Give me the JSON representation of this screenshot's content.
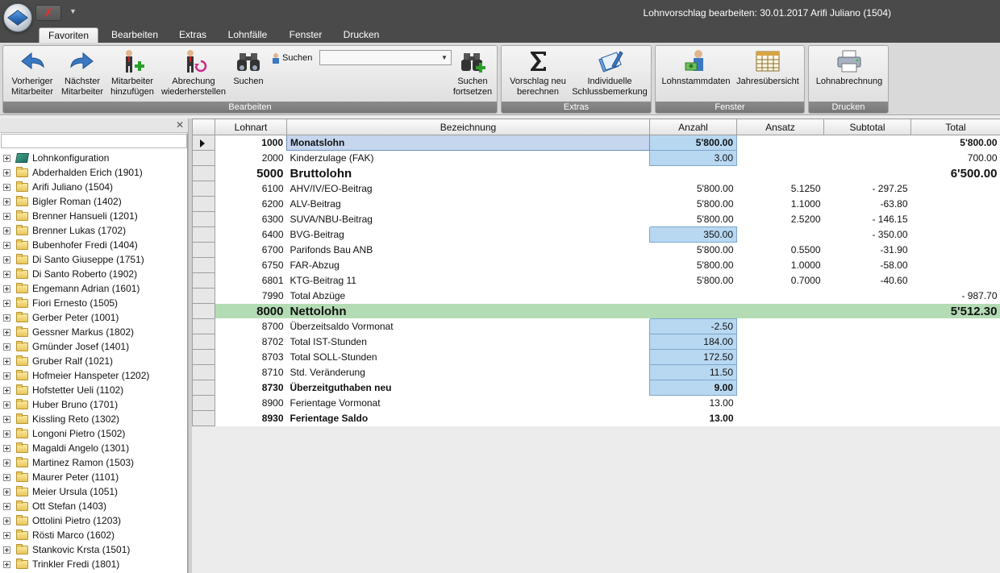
{
  "window": {
    "title": "Lohnvorschlag bearbeiten: 30.01.2017 Arifi Juliano (1504)"
  },
  "tabs": [
    "Favoriten",
    "Bearbeiten",
    "Extras",
    "Lohnfälle",
    "Fenster",
    "Drucken"
  ],
  "ribbon": {
    "bearbeiten": {
      "label": "Bearbeiten",
      "prev_1": "Vorheriger",
      "prev_2": "Mitarbeiter",
      "next_1": "Nächster",
      "next_2": "Mitarbeiter",
      "add_1": "Mitarbeiter",
      "add_2": "hinzufügen",
      "restore_1": "Abrechung",
      "restore_2": "wiederherstellen",
      "search": "Suchen",
      "search_label": "Suchen",
      "search_value": "",
      "continue_1": "Suchen",
      "continue_2": "fortsetzen"
    },
    "extras": {
      "label": "Extras",
      "recalc_1": "Vorschlag neu",
      "recalc_2": "berechnen",
      "remark_1": "Individuelle",
      "remark_2": "Schlussbemerkung"
    },
    "fenster": {
      "label": "Fenster",
      "stamm": "Lohnstammdaten",
      "jahr": "Jahresübersicht"
    },
    "drucken": {
      "label": "Drucken",
      "abrechnung": "Lohnabrechnung"
    }
  },
  "tree": {
    "root": "Lohnkonfiguration",
    "employees": [
      "Abderhalden Erich (1901)",
      "Arifi Juliano (1504)",
      "Bigler Roman (1402)",
      "Brenner Hansueli (1201)",
      "Brenner Lukas (1702)",
      "Bubenhofer Fredi (1404)",
      "Di Santo Giuseppe (1751)",
      "Di Santo Roberto (1902)",
      "Engemann Adrian (1601)",
      "Fiori Ernesto (1505)",
      "Gerber Peter (1001)",
      "Gessner Markus (1802)",
      "Gmünder Josef (1401)",
      "Gruber Ralf (1021)",
      "Hofmeier Hanspeter (1202)",
      "Hofstetter Ueli (1102)",
      "Huber Bruno (1701)",
      "Kissling Reto (1302)",
      "Longoni Pietro (1502)",
      "Magaldi Angelo (1301)",
      "Martinez Ramon (1503)",
      "Maurer Peter (1101)",
      "Meier Ursula (1051)",
      "Ott Stefan (1403)",
      "Ottolini Pietro (1203)",
      "Rösti Marco (1602)",
      "Stankovic Krsta (1501)",
      "Trinkler Fredi (1801)"
    ]
  },
  "grid": {
    "columns": {
      "lohnart": "Lohnart",
      "bezeichnung": "Bezeichnung",
      "anzahl": "Anzahl",
      "ansatz": "Ansatz",
      "subtotal": "Subtotal",
      "total": "Total"
    },
    "rows": [
      {
        "lohnart": "1000",
        "bezeichnung": "Monatslohn",
        "anzahl": "5'800.00",
        "ansatz": "",
        "subtotal": "",
        "total": "5'800.00"
      },
      {
        "lohnart": "2000",
        "bezeichnung": "Kinderzulage (FAK)",
        "anzahl": "3.00",
        "ansatz": "",
        "subtotal": "",
        "total": "700.00"
      },
      {
        "lohnart": "5000",
        "bezeichnung": "Bruttolohn",
        "anzahl": "",
        "ansatz": "",
        "subtotal": "",
        "total": "6'500.00"
      },
      {
        "lohnart": "6100",
        "bezeichnung": "AHV/IV/EO-Beitrag",
        "anzahl": "5'800.00",
        "ansatz": "5.1250",
        "subtotal": "- 297.25",
        "total": ""
      },
      {
        "lohnart": "6200",
        "bezeichnung": "ALV-Beitrag",
        "anzahl": "5'800.00",
        "ansatz": "1.1000",
        "subtotal": "-63.80",
        "total": ""
      },
      {
        "lohnart": "6300",
        "bezeichnung": "SUVA/NBU-Beitrag",
        "anzahl": "5'800.00",
        "ansatz": "2.5200",
        "subtotal": "- 146.15",
        "total": ""
      },
      {
        "lohnart": "6400",
        "bezeichnung": "BVG-Beitrag",
        "anzahl": "350.00",
        "ansatz": "",
        "subtotal": "- 350.00",
        "total": ""
      },
      {
        "lohnart": "6700",
        "bezeichnung": "Parifonds Bau ANB",
        "anzahl": "5'800.00",
        "ansatz": "0.5500",
        "subtotal": "-31.90",
        "total": ""
      },
      {
        "lohnart": "6750",
        "bezeichnung": "FAR-Abzug",
        "anzahl": "5'800.00",
        "ansatz": "1.0000",
        "subtotal": "-58.00",
        "total": ""
      },
      {
        "lohnart": "6801",
        "bezeichnung": "KTG-Beitrag 11",
        "anzahl": "5'800.00",
        "ansatz": "0.7000",
        "subtotal": "-40.60",
        "total": ""
      },
      {
        "lohnart": "7990",
        "bezeichnung": "Total Abzüge",
        "anzahl": "",
        "ansatz": "",
        "subtotal": "",
        "total": "- 987.70"
      },
      {
        "lohnart": "8000",
        "bezeichnung": "Nettolohn",
        "anzahl": "",
        "ansatz": "",
        "subtotal": "",
        "total": "5'512.30"
      },
      {
        "lohnart": "8700",
        "bezeichnung": "Überzeitsaldo Vormonat",
        "anzahl": "-2.50",
        "ansatz": "",
        "subtotal": "",
        "total": ""
      },
      {
        "lohnart": "8702",
        "bezeichnung": "Total IST-Stunden",
        "anzahl": "184.00",
        "ansatz": "",
        "subtotal": "",
        "total": ""
      },
      {
        "lohnart": "8703",
        "bezeichnung": "Total SOLL-Stunden",
        "anzahl": "172.50",
        "ansatz": "",
        "subtotal": "",
        "total": ""
      },
      {
        "lohnart": "8710",
        "bezeichnung": "Std. Veränderung",
        "anzahl": "11.50",
        "ansatz": "",
        "subtotal": "",
        "total": ""
      },
      {
        "lohnart": "8730",
        "bezeichnung": "Überzeitguthaben neu",
        "anzahl": "9.00",
        "ansatz": "",
        "subtotal": "",
        "total": ""
      },
      {
        "lohnart": "8900",
        "bezeichnung": "Ferientage Vormonat",
        "anzahl": "13.00",
        "ansatz": "",
        "subtotal": "",
        "total": ""
      },
      {
        "lohnart": "8930",
        "bezeichnung": "Ferientage Saldo",
        "anzahl": "13.00",
        "ansatz": "",
        "subtotal": "",
        "total": ""
      }
    ]
  }
}
